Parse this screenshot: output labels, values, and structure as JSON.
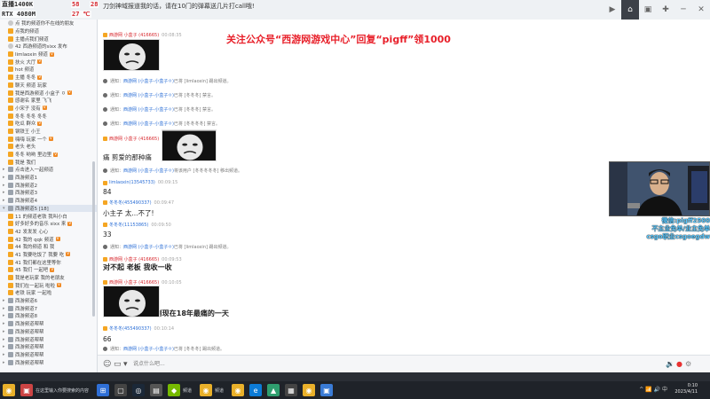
{
  "overlay": {
    "stats": [
      {
        "text": "直播1400K",
        "hot": false
      },
      {
        "text": "58",
        "hot": true
      },
      {
        "text": "28",
        "hot": true
      },
      {
        "text": "RTX 4080M",
        "hot": false
      },
      {
        "text": "27 ℃",
        "hot": true
      },
      {
        "text": "DDR4",
        "hot": false
      },
      {
        "text": "16 ℃",
        "hot": false
      }
    ],
    "room_title": "刀剑神域报道我的话，请在10门的弹幕送几片打call哦!"
  },
  "top_actions": [
    {
      "name": "record-icon",
      "glyph": "▶"
    },
    {
      "name": "home-icon",
      "glyph": "⌂"
    },
    {
      "name": "window-icon",
      "glyph": "▣"
    },
    {
      "name": "gamepad-icon",
      "glyph": "✚"
    },
    {
      "name": "minimize-icon",
      "glyph": "─"
    },
    {
      "name": "close-icon",
      "glyph": "✕"
    }
  ],
  "sidebar": {
    "rows": [
      {
        "tog": "",
        "icon": "mic",
        "label": "点 我的频道你不在线的朋友",
        "badge": ""
      },
      {
        "tog": "",
        "icon": "user",
        "label": "点我的频道",
        "badge": ""
      },
      {
        "tog": "",
        "icon": "user",
        "label": "主播点我们频道",
        "badge": ""
      },
      {
        "tog": "",
        "icon": "mic",
        "label": "42 西游频道的sixx 发布",
        "badge": ""
      },
      {
        "tog": "",
        "icon": "user",
        "label": "Iimlaoxin 频道",
        "badge": "V"
      },
      {
        "tog": "",
        "icon": "user",
        "label": "扶火 大厅",
        "badge": "V"
      },
      {
        "tog": "",
        "icon": "user",
        "label": "hot 频道",
        "badge": ""
      },
      {
        "tog": "",
        "icon": "user",
        "label": "主播 冬冬",
        "badge": "V"
      },
      {
        "tog": "",
        "icon": "user",
        "label": "聊天 频道 玩家",
        "badge": ""
      },
      {
        "tog": "",
        "icon": "user",
        "label": "我是西游频道 小盒子 ㅇ",
        "badge": "V"
      },
      {
        "tog": "",
        "icon": "user",
        "label": "感谢名 家里 飞飞",
        "badge": ""
      },
      {
        "tog": "",
        "icon": "user",
        "label": "小宋子 没有",
        "badge": "V"
      },
      {
        "tog": "",
        "icon": "user",
        "label": "冬冬 冬冬 冬冬",
        "badge": ""
      },
      {
        "tog": "",
        "icon": "user",
        "label": "吃瓜 群众",
        "badge": "V"
      },
      {
        "tog": "",
        "icon": "user",
        "label": "钢铁王 小王",
        "badge": ""
      },
      {
        "tog": "",
        "icon": "user",
        "label": "嗨嗨 玩家 一个",
        "badge": "V"
      },
      {
        "tog": "",
        "icon": "user",
        "label": "老头 老头",
        "badge": ""
      },
      {
        "tog": "",
        "icon": "user",
        "label": "冬冬 哟哟 里边里",
        "badge": "V"
      },
      {
        "tog": "",
        "icon": "user",
        "label": "我是 我们",
        "badge": ""
      },
      {
        "tog": "▸",
        "icon": "ch",
        "label": "点击进入一起频道",
        "badge": ""
      },
      {
        "tog": "▸",
        "icon": "ch",
        "label": "西游频道1",
        "badge": ""
      },
      {
        "tog": "▸",
        "icon": "ch",
        "label": "西游频道2",
        "badge": ""
      },
      {
        "tog": "▸",
        "icon": "ch",
        "label": "西游频道3",
        "badge": ""
      },
      {
        "tog": "▸",
        "icon": "ch",
        "label": "西游频道4",
        "badge": ""
      },
      {
        "tog": "▾",
        "icon": "ch",
        "label": "西游频道5 [18]",
        "badge": "",
        "selected": true
      },
      {
        "tog": "",
        "icon": "user",
        "label": "11 的频道老铁 我叫小白",
        "badge": ""
      },
      {
        "tog": "",
        "icon": "user",
        "label": "好多好多的音乐 sixx 来",
        "badge": "V"
      },
      {
        "tog": "",
        "icon": "user",
        "label": "42 发发发 心心",
        "badge": ""
      },
      {
        "tog": "",
        "icon": "user",
        "label": "42 我的 qqk 频道",
        "badge": "V"
      },
      {
        "tog": "",
        "icon": "user",
        "label": "44 我的频道 和 我",
        "badge": ""
      },
      {
        "tog": "",
        "icon": "user",
        "label": "41 我要吃饭了 我要 吃",
        "badge": "V"
      },
      {
        "tog": "",
        "icon": "user",
        "label": "41 我们都在这里等你",
        "badge": ""
      },
      {
        "tog": "",
        "icon": "user",
        "label": "45 我们 一起吧",
        "badge": "V"
      },
      {
        "tog": "",
        "icon": "user",
        "label": "我是老玩家 我的老朋友",
        "badge": ""
      },
      {
        "tog": "",
        "icon": "user",
        "label": "我们在一起玩 啦啦",
        "badge": "V"
      },
      {
        "tog": "",
        "icon": "user",
        "label": "老铁 玩家 一起啦",
        "badge": ""
      },
      {
        "tog": "▸",
        "icon": "ch",
        "label": "西游频道6",
        "badge": ""
      },
      {
        "tog": "▸",
        "icon": "ch",
        "label": "西游频道7",
        "badge": ""
      },
      {
        "tog": "▸",
        "icon": "ch",
        "label": "西游频道8",
        "badge": ""
      },
      {
        "tog": "▸",
        "icon": "ch",
        "label": "西游频道帮帮",
        "badge": ""
      },
      {
        "tog": "▸",
        "icon": "ch",
        "label": "西游频道帮帮",
        "badge": ""
      },
      {
        "tog": "▸",
        "icon": "ch",
        "label": "西游频道帮帮",
        "badge": ""
      },
      {
        "tog": "▸",
        "icon": "ch",
        "label": "西游频道帮帮",
        "badge": ""
      },
      {
        "tog": "▸",
        "icon": "ch",
        "label": "西游频道帮帮",
        "badge": ""
      },
      {
        "tog": "▸",
        "icon": "ch",
        "label": "西游频道帮帮",
        "badge": ""
      }
    ]
  },
  "chat": {
    "promo": "关注公众号“西游网游戏中心”回复“pigff”领1000",
    "messages": [
      {
        "kind": "head",
        "nick": "西游网 小盒子 (416665)",
        "time": "00:08:35",
        "vip": true
      },
      {
        "kind": "sys",
        "text": "通知：",
        "who": "西游网 (小盒子-小盒子ㅇ)",
        "rest": "已将 [limlaoxin] 踢出频道。"
      },
      {
        "kind": "sys",
        "text": "通知：",
        "who": "西游网 (小盒子-小盒子ㅇ)",
        "rest": "已将 [冬冬冬] 禁言。"
      },
      {
        "kind": "sys",
        "text": "通知：",
        "who": "西游网 (小盒子-小盒子ㅇ)",
        "rest": "已将 [冬冬冬] 禁言。"
      },
      {
        "kind": "sys",
        "text": "通知：",
        "who": "西游网 (小盒子-小盒子ㅇ)",
        "rest": "已将 [冬冬冬冬] 禁言。"
      },
      {
        "kind": "head",
        "nick": "西游网 小盒子 (416665)",
        "time": "00:09:04",
        "vip": true
      },
      {
        "kind": "text",
        "text": "痛 剪爱的那种痛",
        "big": false
      },
      {
        "kind": "sys",
        "text": "通知：",
        "who": "西游网 (小盒子-小盒子ㅇ)",
        "rest": "将该用户 [冬冬冬冬冬] 移出频道。"
      },
      {
        "kind": "head",
        "nick": "limlaoxin(13545733)",
        "time": "00:09:15",
        "vip": false
      },
      {
        "kind": "text",
        "text": "84",
        "big": false
      },
      {
        "kind": "head",
        "nick": "冬冬冬(455490337)",
        "time": "00:09:47",
        "vip": false
      },
      {
        "kind": "text",
        "text": "小主子 太...不了!",
        "big": false
      },
      {
        "kind": "head",
        "nick": "冬冬冬(11153865)",
        "time": "00:09:50",
        "vip": false
      },
      {
        "kind": "text",
        "text": "33",
        "big": false
      },
      {
        "kind": "sys",
        "text": "通知：",
        "who": "西游网 (小盒子-小盒子ㅇ)",
        "rest": "已将 [limlaoxin] 踢出频道。"
      },
      {
        "kind": "head",
        "nick": "西游网 小盒子 (416665)",
        "time": "00:09:53",
        "vip": true
      },
      {
        "kind": "text",
        "text": "对不起 老板 我收一收",
        "big": true
      },
      {
        "kind": "head",
        "nick": "西游网 小盒子 (416665)",
        "time": "00:10:05",
        "vip": true
      },
      {
        "kind": "text",
        "text": "老板 这是我出生到现在18年最痛的一天",
        "big": true
      },
      {
        "kind": "head",
        "nick": "冬冬冬(455490337)",
        "time": "00:10:14",
        "vip": false
      },
      {
        "kind": "text",
        "text": "66",
        "big": false
      },
      {
        "kind": "sys",
        "text": "通知：",
        "who": "西游网 (小盒子-小盒子ㅇ)",
        "rest": "已将 [冬冬冬] 踢出频道。"
      }
    ]
  },
  "webcam": {
    "caption": [
      "微信:pigff2500",
      "不主业免单/业主免单",
      "csgo职业csgoegdw"
    ]
  },
  "inputbar": {
    "placeholder": "说点什么吧...",
    "send_label": "发送"
  },
  "taskbar": {
    "search_text": "在这里输入你要搜索的内容",
    "app_label": "频道",
    "app_label2": "频道",
    "tray_text": "^ 📶 🔊 中",
    "time": "0:10",
    "date": "2023/4/11"
  },
  "colors": {
    "promo": "#e8202a",
    "nick": "#2c6fd6",
    "cam_caption": "#59c8ff"
  }
}
